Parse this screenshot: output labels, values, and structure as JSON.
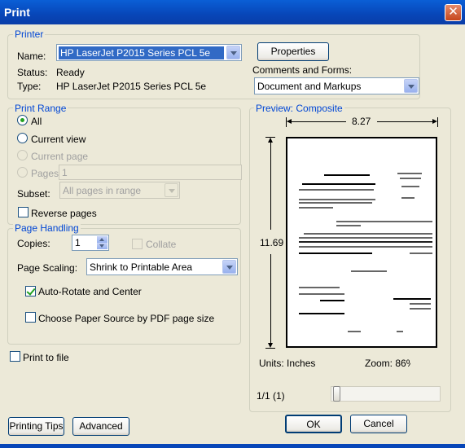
{
  "window": {
    "title": "Print"
  },
  "printer": {
    "legend": "Printer",
    "name_label": "Name:",
    "name_value": "HP LaserJet P2015 Series PCL 5e",
    "status_label": "Status:",
    "status_value": "Ready",
    "type_label": "Type:",
    "type_value": "HP LaserJet P2015 Series PCL 5e",
    "properties_button": "Properties",
    "comments_label": "Comments and Forms:",
    "comments_value": "Document and Markups"
  },
  "print_range": {
    "legend": "Print Range",
    "all": "All",
    "current_view": "Current view",
    "current_page": "Current page",
    "pages": "Pages",
    "pages_value": "1",
    "subset_label": "Subset:",
    "subset_value": "All pages in range",
    "reverse_pages": "Reverse pages",
    "selected": "All"
  },
  "page_handling": {
    "legend": "Page Handling",
    "copies_label": "Copies:",
    "copies_value": "1",
    "collate": "Collate",
    "scaling_label": "Page Scaling:",
    "scaling_value": "Shrink to Printable Area",
    "auto_rotate": "Auto-Rotate and Center",
    "auto_rotate_checked": true,
    "choose_source": "Choose Paper Source by PDF page size",
    "choose_source_checked": false
  },
  "print_to_file": "Print to file",
  "preview": {
    "legend": "Preview: Composite",
    "width": "8.27",
    "height": "11.69",
    "units": "Units: Inches",
    "zoom": "Zoom:  86%",
    "page_indicator": "1/1 (1)"
  },
  "buttons": {
    "printing_tips": "Printing Tips",
    "advanced": "Advanced",
    "ok": "OK",
    "cancel": "Cancel"
  }
}
